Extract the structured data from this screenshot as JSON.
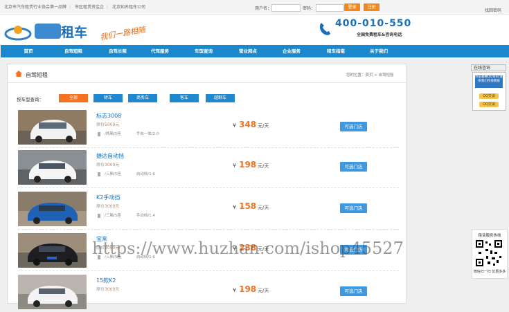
{
  "topbar": {
    "slogans": [
      "北京市汽车租赁行业协会第一品牌",
      "市区租赁资金企",
      "北京知名租车公司"
    ],
    "username_label": "用户名：",
    "password_label": "密码：",
    "login_button": "登录",
    "register_button": "注册",
    "forgot_password": "找回密码"
  },
  "header": {
    "logo_text": "租车",
    "logo_slogan": "我们一路相随",
    "phone_number": "400-010-550",
    "phone_subtitle": "全国免费租车&咨询电话"
  },
  "nav": {
    "items": [
      "首页",
      "自驾短租",
      "自驾长租",
      "代驾服务",
      "车型查询",
      "营业网点",
      "企业服务",
      "租车指南",
      "关于我们"
    ]
  },
  "main": {
    "section_title": "自驾短租",
    "breadcrumb": "您的位置：首页 > 自驾短租",
    "filter_label": "按车型查询：",
    "filters": [
      "全部",
      "轿车",
      "商务车",
      "客车",
      "越野车"
    ],
    "cars": [
      {
        "name": "标志3008",
        "orig_label": "原价",
        "orig_price": "5000元",
        "spec1": "/两厢/5座",
        "spec2": "手自一体/2.0",
        "price": "348",
        "currency": "¥",
        "unit": "元/天",
        "store_button": "可选门店"
      },
      {
        "name": "捷达自动挡",
        "orig_label": "原价",
        "orig_price": "3000元",
        "spec1": "/三厢/5座",
        "spec2": "自动档/1.6",
        "price": "198",
        "currency": "¥",
        "unit": "元/天",
        "store_button": "可选门店"
      },
      {
        "name": "K2手动挡",
        "orig_label": "原价",
        "orig_price": "3000元",
        "spec1": "/三厢/5座",
        "spec2": "手动档/1.4",
        "price": "158",
        "currency": "¥",
        "unit": "元/天",
        "store_button": "可选门店"
      },
      {
        "name": "宝来",
        "orig_label": "原价",
        "orig_price": "3000元",
        "spec1": "/三厢/5座",
        "spec2": "自动档/1.6",
        "price": "238",
        "currency": "¥",
        "unit": "元/天",
        "store_button": "可选门店"
      },
      {
        "name": "15款K2",
        "orig_label": "原价",
        "orig_price": "3000元",
        "spec1": "",
        "spec2": "",
        "price": "198",
        "currency": "¥",
        "unit": "元/天",
        "store_button": "可选门店"
      }
    ]
  },
  "right_panel": {
    "title": "在线咨询",
    "ad_text": "点击查看QQ号码 联系我们在线客服",
    "qq_button": "QQ交谈"
  },
  "qr": {
    "title": "租赁服务热线",
    "caption": "微信扫一扫 优惠多多"
  },
  "watermark": "https://www.huzhan.com/ishop45527",
  "colors": {
    "nav_blue": "#1b87cd",
    "accent_orange": "#f57220",
    "store_blue": "#3d9ae2"
  }
}
